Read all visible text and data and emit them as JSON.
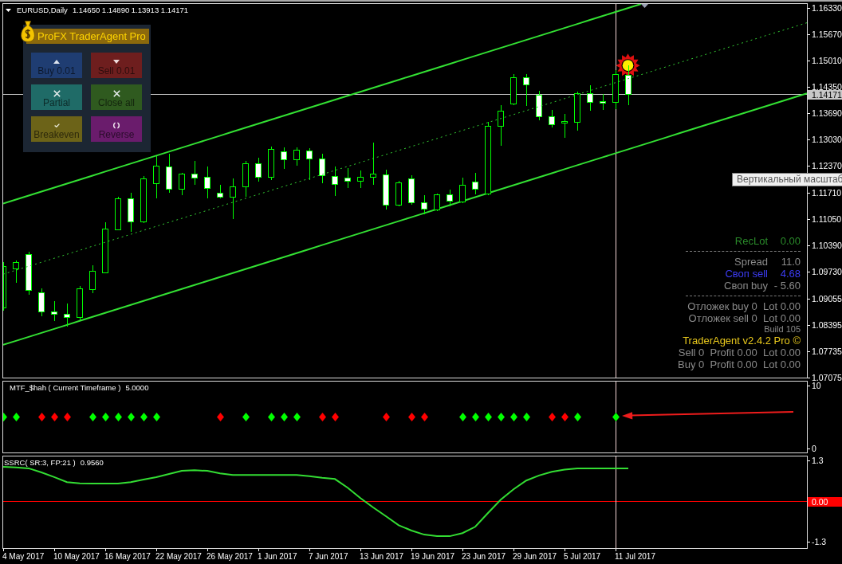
{
  "chart": {
    "chart_data": [
      {
        "type": "candlestick",
        "title": "EURUSD,Daily",
        "subtitle": "1.14650 1.14890 1.13913 1.14171",
        "categories": [
          null,
          null,
          null,
          null,
          null,
          null,
          null,
          null,
          null,
          null,
          null,
          null,
          null,
          null,
          null,
          null,
          null,
          null,
          null,
          null,
          null,
          null,
          null,
          null,
          null,
          null,
          null,
          null,
          null,
          null,
          null,
          null,
          null,
          null,
          null,
          null,
          null,
          null,
          null,
          null,
          null,
          null,
          null,
          null,
          null,
          null,
          null,
          null,
          null,
          null,
          null,
          null,
          null,
          null,
          null,
          null,
          null,
          null,
          null,
          null,
          null,
          null,
          null,
          null
        ],
        "ylim": [
          1.0707,
          1.1643
        ],
        "yticks": [
          {
            "value": 1.1633,
            "label": "1.16330"
          },
          {
            "value": 1.1567,
            "label": "1.15670"
          },
          {
            "value": 1.1501,
            "label": "1.15010"
          },
          {
            "value": 1.1435,
            "label": "1.14350"
          },
          {
            "value": 1.1369,
            "label": "1.13690"
          },
          {
            "value": 1.1303,
            "label": "1.13030"
          },
          {
            "value": 1.1237,
            "label": "1.12370"
          },
          {
            "value": 1.1171,
            "label": "1.11710"
          },
          {
            "value": 1.1105,
            "label": "1.11050"
          },
          {
            "value": 1.1039,
            "label": "1.10390"
          },
          {
            "value": 1.0973,
            "label": "1.09730"
          },
          {
            "value": 1.09055,
            "label": "1.09055"
          },
          {
            "value": 1.08395,
            "label": "1.08395"
          },
          {
            "value": 1.07735,
            "label": "1.07735"
          },
          {
            "value": 1.07075,
            "label": "1.07075"
          }
        ],
        "ohlc": [
          [
            1.0883,
            1.0997,
            1.0877,
            1.0987
          ],
          [
            1.0981,
            1.1001,
            1.0947,
            1.0997
          ],
          [
            1.1017,
            1.1023,
            1.0917,
            1.0927
          ],
          [
            1.0921,
            1.0931,
            1.0863,
            1.0873
          ],
          [
            1.0873,
            1.0899,
            1.0851,
            1.0867
          ],
          [
            1.0867,
            1.0893,
            1.0837,
            1.0859
          ],
          [
            1.0859,
            1.0937,
            1.0853,
            1.0931
          ],
          [
            1.0929,
            1.0989,
            1.0921,
            1.0975
          ],
          [
            1.0971,
            1.1097,
            1.0971,
            1.1081
          ],
          [
            1.1079,
            1.1161,
            1.1079,
            1.1157
          ],
          [
            1.1157,
            1.1171,
            1.1075,
            1.1099
          ],
          [
            1.1099,
            1.1211,
            1.1097,
            1.1205
          ],
          [
            1.1193,
            1.1261,
            1.1159,
            1.1237
          ],
          [
            1.1235,
            1.1267,
            1.1173,
            1.1179
          ],
          [
            1.1179,
            1.1219,
            1.1167,
            1.1217
          ],
          [
            1.1217,
            1.1249,
            1.1191,
            1.1207
          ],
          [
            1.1209,
            1.1235,
            1.1159,
            1.1181
          ],
          [
            1.1171,
            1.1189,
            1.1159,
            1.1161
          ],
          [
            1.1161,
            1.1205,
            1.1107,
            1.1185
          ],
          [
            1.1185,
            1.1249,
            1.1163,
            1.1243
          ],
          [
            1.1243,
            1.1257,
            1.1199,
            1.1209
          ],
          [
            1.1209,
            1.1285,
            1.1203,
            1.1279
          ],
          [
            1.1273,
            1.1283,
            1.1231,
            1.1253
          ],
          [
            1.1253,
            1.1283,
            1.1239,
            1.1277
          ],
          [
            1.1275,
            1.1281,
            1.1203,
            1.1255
          ],
          [
            1.1255,
            1.1267,
            1.1195,
            1.1213
          ],
          [
            1.1211,
            1.1235,
            1.1165,
            1.1191
          ],
          [
            1.1207,
            1.1231,
            1.1183,
            1.1199
          ],
          [
            1.1199,
            1.1225,
            1.1183,
            1.1209
          ],
          [
            1.1209,
            1.1295,
            1.1191,
            1.1217
          ],
          [
            1.1215,
            1.1227,
            1.1131,
            1.1141
          ],
          [
            1.1141,
            1.1199,
            1.1139,
            1.1195
          ],
          [
            1.1205,
            1.1213,
            1.1143,
            1.1147
          ],
          [
            1.1147,
            1.1165,
            1.1119,
            1.1131
          ],
          [
            1.1129,
            1.1169,
            1.1127,
            1.1167
          ],
          [
            1.1167,
            1.1177,
            1.1139,
            1.1151
          ],
          [
            1.1149,
            1.1207,
            1.1147,
            1.1189
          ],
          [
            1.1197,
            1.1219,
            1.1169,
            1.1179
          ],
          [
            1.1169,
            1.1347,
            1.1167,
            1.1337
          ],
          [
            1.1337,
            1.1389,
            1.1289,
            1.1375
          ],
          [
            1.1393,
            1.1467,
            1.1391,
            1.1459
          ],
          [
            1.1459,
            1.1467,
            1.1389,
            1.1441
          ],
          [
            1.1415,
            1.1425,
            1.1353,
            1.1361
          ],
          [
            1.1361,
            1.1377,
            1.1335,
            1.1341
          ],
          [
            1.1345,
            1.1367,
            1.1309,
            1.1349
          ],
          [
            1.1347,
            1.1423,
            1.1327,
            1.1419
          ],
          [
            1.1419,
            1.1439,
            1.1377,
            1.1397
          ],
          [
            1.1399,
            1.1417,
            1.1379,
            1.1395
          ],
          [
            1.1397,
            1.1477,
            1.1381,
            1.1467
          ],
          [
            1.1465,
            1.1489,
            1.13913,
            1.14171
          ],
          null,
          null,
          null,
          null,
          null,
          null,
          null,
          null,
          null,
          null,
          null,
          null,
          null,
          null
        ],
        "series": [
          {
            "type": "line",
            "color": "#33e033",
            "values": [
              1.1143,
              1.1153,
              1.1163,
              1.1173,
              1.1183,
              1.1193,
              1.1203,
              1.1213,
              1.1223,
              1.1233,
              1.1243,
              1.1253,
              1.1263,
              1.1273,
              1.1283,
              1.1293,
              1.1303,
              1.1313,
              1.1323,
              1.1333,
              1.1343,
              1.1353,
              1.1363,
              1.1373,
              1.1383,
              1.1393,
              1.1403,
              1.1413,
              1.1423,
              1.1433,
              1.1443,
              1.1453,
              1.1463,
              1.1473,
              1.1483,
              1.1493,
              1.1503,
              1.1513,
              1.1523,
              1.1533,
              1.1543,
              1.1553,
              1.1563,
              1.1573,
              1.1583,
              1.1593,
              1.1603,
              1.1613,
              1.1623,
              1.1633,
              1.1643,
              null,
              null,
              null,
              null,
              null,
              null,
              null,
              null,
              null,
              null,
              null,
              null,
              null
            ]
          },
          {
            "type": "line",
            "color": "#33cc33",
            "line_style": "dashed",
            "values": [
              1.0966,
              1.0976,
              1.0986,
              1.0996,
              1.1006,
              1.1016,
              1.1026,
              1.1036,
              1.1046,
              1.1056,
              1.1066,
              1.1076,
              1.1086,
              1.1096,
              1.1106,
              1.1116,
              1.1126,
              1.1136,
              1.1146,
              1.1156,
              1.1166,
              1.1176,
              1.1186,
              1.1196,
              1.1206,
              1.1216,
              1.1226,
              1.1236,
              1.1246,
              1.1256,
              1.1266,
              1.1276,
              1.1286,
              1.1296,
              1.1306,
              1.1316,
              1.1326,
              1.1336,
              1.1346,
              1.1356,
              1.1366,
              1.1376,
              1.1386,
              1.1396,
              1.1406,
              1.1416,
              1.1426,
              1.1436,
              1.1446,
              1.1456,
              1.1466,
              1.1476,
              1.1486,
              1.1496,
              1.1506,
              1.1516,
              1.1526,
              1.1536,
              1.1546,
              1.1556,
              1.1566,
              1.1576,
              1.1586,
              1.1596
            ]
          },
          {
            "type": "line",
            "color": "#33e033",
            "values": [
              1.0789,
              1.0799,
              1.0809,
              1.0819,
              1.0829,
              1.0839,
              1.0849,
              1.0859,
              1.0869,
              1.0879,
              1.0889,
              1.0899,
              1.0909,
              1.0919,
              1.0929,
              1.0939,
              1.0949,
              1.0959,
              1.0969,
              1.0979,
              1.0989,
              1.0999,
              1.1009,
              1.1019,
              1.1029,
              1.1039,
              1.1049,
              1.1059,
              1.1069,
              1.1079,
              1.1089,
              1.1099,
              1.1109,
              1.1119,
              1.1129,
              1.1139,
              1.1149,
              1.1159,
              1.1169,
              1.1179,
              1.1189,
              1.1199,
              1.1209,
              1.1219,
              1.1229,
              1.1239,
              1.1249,
              1.1259,
              1.1269,
              1.1279,
              1.1289,
              1.1299,
              1.1309,
              1.1319,
              1.1329,
              1.1339,
              1.1349,
              1.1359,
              1.1369,
              1.1379,
              1.1389,
              1.1399,
              1.1409,
              1.1419
            ]
          }
        ],
        "ref_lines": [
          {
            "axis": "y",
            "value": 1.14171,
            "label": "1.14171",
            "color": "#c8c8c8"
          }
        ]
      },
      {
        "type": "scatter",
        "title": "MTF_$hah ( Current Timeframe )",
        "subtitle": "5.0000",
        "categories": [
          null,
          null,
          null,
          null,
          null,
          null,
          null,
          null,
          null,
          null,
          null,
          null,
          null,
          null,
          null,
          null,
          null,
          null,
          null,
          null,
          null,
          null,
          null,
          null,
          null,
          null,
          null,
          null,
          null,
          null,
          null,
          null,
          null,
          null,
          null,
          null,
          null,
          null,
          null,
          null,
          null,
          null,
          null,
          null,
          null,
          null,
          null,
          null,
          null,
          null,
          null,
          null,
          null,
          null,
          null,
          null,
          null,
          null,
          null,
          null,
          null,
          null,
          null,
          null
        ],
        "ylim": [
          -0.64,
          10.64
        ],
        "yticks": [
          10,
          0
        ],
        "marker": "diamond",
        "values": [
          5,
          5,
          null,
          5,
          5,
          5,
          null,
          5,
          5,
          5,
          5,
          5,
          5,
          null,
          null,
          null,
          null,
          5,
          null,
          5,
          null,
          5,
          5,
          5,
          null,
          5,
          5,
          null,
          null,
          null,
          5,
          null,
          5,
          5,
          null,
          null,
          5,
          5,
          5,
          5,
          5,
          5,
          null,
          5,
          5,
          5,
          null,
          null,
          5,
          null,
          null,
          null,
          null,
          null,
          null,
          null,
          null,
          null,
          null,
          null,
          null,
          null,
          null,
          null
        ],
        "colors": [
          "#00ff00",
          "#00ff00",
          null,
          "#ff0000",
          "#ff0000",
          "#ff0000",
          null,
          "#00ff00",
          "#00ff00",
          "#00ff00",
          "#00ff00",
          "#00ff00",
          "#00ff00",
          null,
          null,
          null,
          null,
          "#ff0000",
          null,
          "#00ff00",
          null,
          "#00ff00",
          "#00ff00",
          "#00ff00",
          null,
          "#ff0000",
          "#ff0000",
          null,
          null,
          null,
          "#ff0000",
          null,
          "#ff0000",
          "#ff0000",
          null,
          null,
          "#00ff00",
          "#00ff00",
          "#00ff00",
          "#00ff00",
          "#00ff00",
          "#00ff00",
          null,
          "#ff0000",
          "#ff0000",
          "#00ff00",
          null,
          null,
          "#00ff00",
          null,
          null,
          null,
          null,
          null,
          null,
          null,
          null,
          null,
          null,
          null,
          null,
          null,
          null,
          null
        ]
      },
      {
        "type": "line",
        "title": "SSRC( SR:3, FP:21 )",
        "subtitle": "0.9560",
        "categories": [
          null,
          null,
          null,
          null,
          null,
          null,
          null,
          null,
          null,
          null,
          null,
          null,
          null,
          null,
          null,
          null,
          null,
          null,
          null,
          null,
          null,
          null,
          null,
          null,
          null,
          null,
          null,
          null,
          null,
          null,
          null,
          null,
          null,
          null,
          null,
          null,
          null,
          null,
          null,
          null,
          null,
          null,
          null,
          null,
          null,
          null,
          null,
          null,
          null,
          null,
          null,
          null,
          null,
          null,
          null,
          null,
          null,
          null,
          null,
          null,
          null,
          null,
          null,
          null
        ],
        "ylim": [
          -1.5,
          1.43
        ],
        "yticks": [
          1.3,
          -1.3
        ],
        "color": "#33dd33",
        "values": [
          1.1,
          1.08,
          1.05,
          0.92,
          0.77,
          0.61,
          0.57,
          0.56,
          0.56,
          0.56,
          0.61,
          0.69,
          0.77,
          0.87,
          0.97,
          0.99,
          0.97,
          0.89,
          0.84,
          0.84,
          0.84,
          0.84,
          0.84,
          0.84,
          0.8,
          0.75,
          0.71,
          0.43,
          0.1,
          -0.2,
          -0.48,
          -0.77,
          -0.94,
          -1.07,
          -1.12,
          -1.12,
          -1.02,
          -0.82,
          -0.38,
          0.05,
          0.38,
          0.66,
          0.82,
          0.94,
          1.01,
          1.05,
          1.05,
          1.05,
          1.05,
          1.05,
          null,
          null,
          null,
          null,
          null,
          null,
          null,
          null,
          null,
          null,
          null,
          null,
          null,
          null
        ],
        "ref_lines": [
          {
            "axis": "y",
            "value": 0,
            "label": "0.00",
            "color": "#ff0000"
          }
        ]
      }
    ],
    "time_scale": {
      "labels": [
        "4 May 2017",
        "10 May 2017",
        "16 May 2017",
        "22 May 2017",
        "26 May 2017",
        "1 Jun 2017",
        "7 Jun 2017",
        "13 Jun 2017",
        "19 Jun 2017",
        "23 Jun 2017",
        "29 Jun 2017",
        "5 Jul 2017",
        "11 Jul 2017"
      ]
    }
  },
  "trade_panel": {
    "title": "ProFX TraderAgent Pro",
    "buttons": [
      {
        "label": "Buy 0.01",
        "kind": "buy",
        "color": "#1f3d72"
      },
      {
        "label": "Sell 0.01",
        "kind": "sell",
        "color": "#6e1e1e"
      },
      {
        "label": "Partial",
        "kind": "partial",
        "color": "#1f6b67"
      },
      {
        "label": "Close all",
        "kind": "close",
        "color": "#2f5a1f"
      },
      {
        "label": "Breakeven",
        "kind": "breakeven",
        "color": "#6c6318"
      },
      {
        "label": "Reverse",
        "kind": "reverse",
        "color": "#6a1c6c"
      }
    ]
  },
  "account_panel": {
    "lines": [
      {
        "kind": "pair",
        "label": "RecLot",
        "value": "0.00",
        "color": "#2a8a2a"
      },
      {
        "kind": "separator"
      },
      {
        "kind": "pair",
        "label": "Spread",
        "value": "11.0",
        "color": "#8a8a8a"
      },
      {
        "kind": "pair",
        "label": "Своп sell",
        "value": "4.68",
        "color": "#3c3cf5"
      },
      {
        "kind": "pair",
        "label": "Своп buy",
        "value": "- 5.60",
        "color": "#8a8a8a"
      },
      {
        "kind": "separator"
      },
      {
        "kind": "text",
        "text": "Отложек buy 0  Lot 0.00",
        "color": "#8a8a8a"
      },
      {
        "kind": "text",
        "text": "Отложек sell 0  Lot 0.00",
        "color": "#8a8a8a"
      },
      {
        "kind": "build",
        "text": "Build 105",
        "color": "#8a8a8a"
      },
      {
        "kind": "brand",
        "text": "TraderAgent v2.4.2 Pro ©",
        "color": "#e8c81c"
      },
      {
        "kind": "text",
        "text": "Sell 0  Profit 0.00  Lot 0.00",
        "color": "#8a8a8a"
      },
      {
        "kind": "text",
        "text": "Buy 0  Profit 0.00  Lot 0.00",
        "color": "#8a8a8a"
      }
    ]
  },
  "tooltip": {
    "text": "Вертикальный масштаб"
  }
}
